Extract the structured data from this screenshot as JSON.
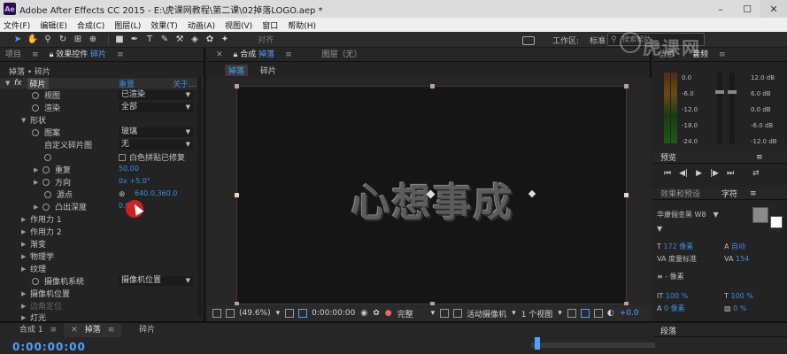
{
  "window": {
    "logo": "Ae",
    "title": "Adobe After Effects CC 2015 - E:\\虎课网教程\\第二课\\02掉落LOGO.aep *",
    "minimize": "–",
    "maximize": "☐",
    "close": "✕"
  },
  "menu": [
    "文件(F)",
    "编辑(E)",
    "合成(C)",
    "图层(L)",
    "效果(T)",
    "动画(A)",
    "视图(V)",
    "窗口",
    "帮助(H)"
  ],
  "toolbar": {
    "tools": [
      "selection-tool",
      "hand-tool",
      "zoom-tool",
      "rotate-tool",
      "camera-tool",
      "pan-behind-tool",
      "rectangle-tool",
      "pen-tool",
      "type-tool",
      "brush-tool",
      "clone-stamp-tool",
      "eraser-tool",
      "roto-brush-tool",
      "puppet-pin-tool"
    ],
    "align_label": "对齐",
    "workspace_label": "工作区:",
    "workspace_value": "标准",
    "search_placeholder": "搜索帮助"
  },
  "left_panel": {
    "tabs": {
      "project": "项目",
      "effects_controls": "效果控件",
      "effects_target": "碎片"
    },
    "breadcrumb": "掉落 • 碎片",
    "fx": {
      "label": "fx",
      "name": "碎片",
      "reset": "重置",
      "about": "关于..."
    },
    "props": {
      "view": {
        "label": "视图",
        "value": "已渲染"
      },
      "render": {
        "label": "渲染",
        "value": "全部"
      },
      "shape": {
        "label": "形状"
      },
      "pattern": {
        "label": "图案",
        "value": "玻璃"
      },
      "custom_map": {
        "label": "自定义碎片图",
        "value": "无"
      },
      "white_tiles": {
        "label": "白色拼贴已修复"
      },
      "repetitions": {
        "label": "重复",
        "value": "50.00"
      },
      "direction": {
        "label": "方向",
        "value": "0x +5.0°"
      },
      "origin": {
        "label": "源点",
        "value": "640.0,360.0"
      },
      "extrusion": {
        "label": "凸出深度",
        "value": "0.00"
      },
      "force1": {
        "label": "作用力 1"
      },
      "force2": {
        "label": "作用力 2"
      },
      "gradient": {
        "label": "渐变"
      },
      "physics": {
        "label": "物理学"
      },
      "texture": {
        "label": "纹理"
      },
      "camera_system": {
        "label": "摄像机系统",
        "value": "摄像机位置"
      },
      "camera_position": {
        "label": "摄像机位置"
      },
      "corner_pins": {
        "label": "边角定位"
      },
      "lighting": {
        "label": "灯光"
      }
    }
  },
  "center_panel": {
    "comp_tab_prefix": "合成",
    "comp_tab_name": "掉落",
    "layer_tab": "图层（无）",
    "subtabs": [
      "掉落",
      "碎片"
    ],
    "logo_text": "心想事成",
    "viewer_bar": {
      "zoom": "(49.6%)",
      "timecode": "0:00:00:00",
      "resolution": "完整",
      "camera": "活动摄像机",
      "views": "1 个视图",
      "exposure": "+0.0"
    }
  },
  "right_panel": {
    "info_tab": "信息",
    "audio_tab": "音频",
    "meter_left": [
      "0.0",
      "-6.0",
      "-12.0",
      "-18.0",
      "-24.0"
    ],
    "meter_right": [
      "12.0 dB",
      "6.0 dB",
      "0.0 dB",
      "-6.0 dB",
      "-12.0 dB"
    ],
    "preview_tab": "预览",
    "effects_tab": "效果和预设",
    "character_tab": "字符",
    "font_name": "华康俪金黑 W8",
    "font_size": "172 像素",
    "leading": "自动",
    "kerning": "度量标准",
    "tracking": "154",
    "stroke_width": "- 像素",
    "vscale": "100 %",
    "hscale": "100 %",
    "baseline": "0 像素",
    "tsume": "0 %",
    "paragraph_tab": "段落",
    "colors": {
      "fill": "#8a8a8a",
      "stroke": "#ffffff"
    }
  },
  "timeline": {
    "tabs": [
      "合成 1",
      "掉落",
      "碎片"
    ],
    "timecode": "0:00:00:00"
  },
  "watermark": "虎课网",
  "colors": {
    "accent": "#4ea3ff",
    "panel": "#232323",
    "canvas": "#151515"
  }
}
